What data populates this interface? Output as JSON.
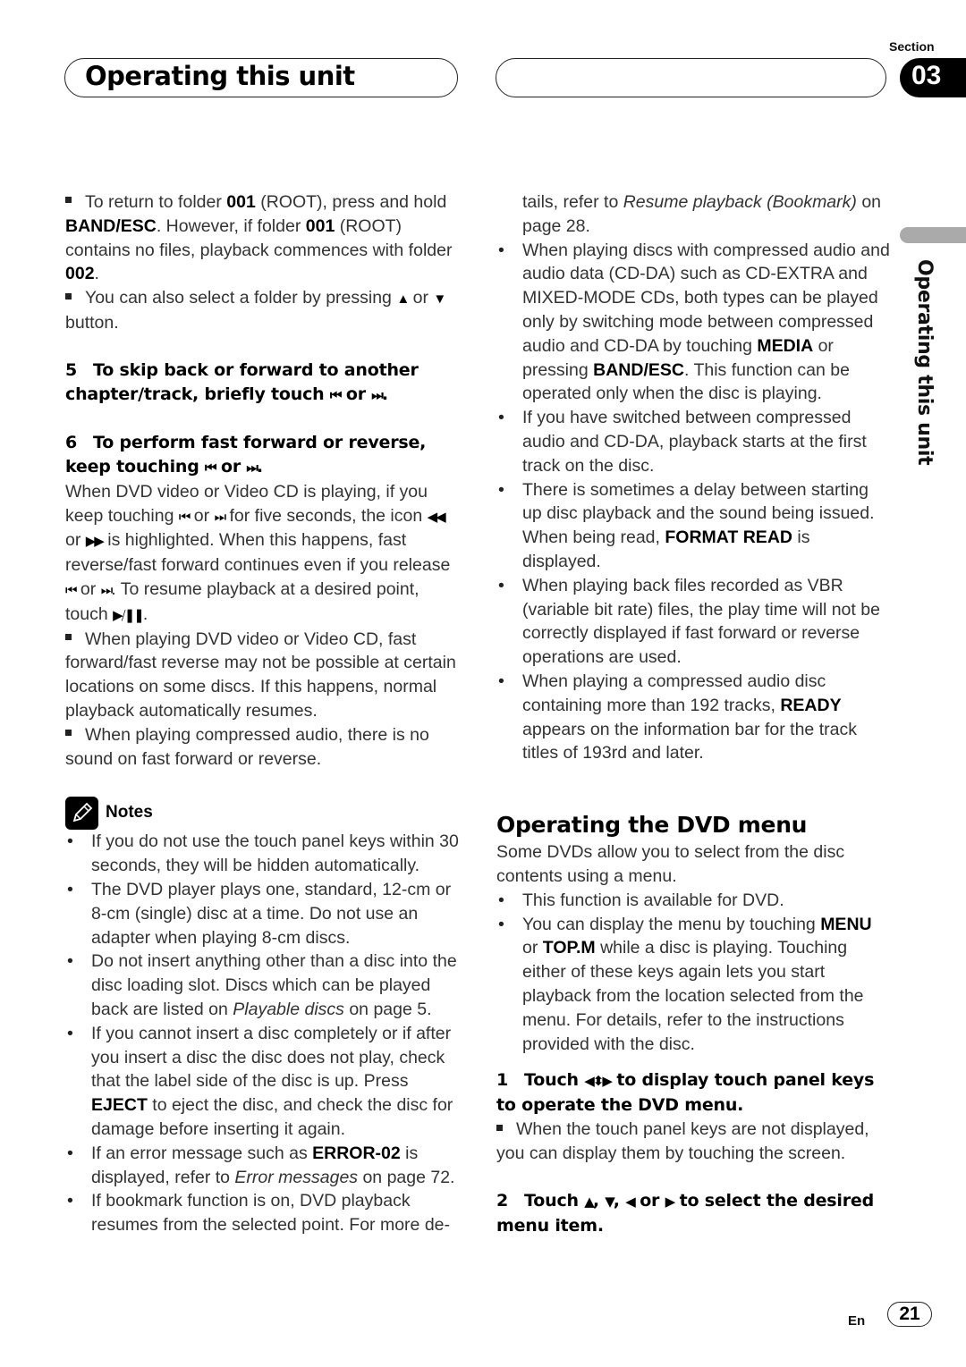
{
  "header": {
    "title": "Operating this unit",
    "section_label": "Section",
    "section_number": "03"
  },
  "side_tab": {
    "label": "Operating this unit"
  },
  "left_column": {
    "p1": {
      "a": "To return to folder ",
      "b1": "001",
      "c": " (ROOT), press and hold ",
      "b2": "BAND/ESC",
      "d": ". However, if folder ",
      "b3": "001",
      "e": " (ROOT) contains no files, playback commences with folder ",
      "b4": "002",
      "f": "."
    },
    "p2": {
      "a": "You can also select a folder by pressing ",
      "up": "▲",
      "b": " or ",
      "down": "▼",
      "c": " button."
    },
    "step5": {
      "num": "5",
      "text": "To skip back or forward to another chapter/track, briefly touch ",
      "prev": "⏮",
      "or": " or ",
      "next": "⏭",
      "end": "."
    },
    "step6": {
      "num": "6",
      "text": "To perform fast forward or reverse, keep touching ",
      "prev": "⏮",
      "or": " or ",
      "next": "⏭",
      "end": "."
    },
    "step6_body": {
      "a": "When DVD video or Video CD is playing, if you keep touching ",
      "prev": "⏮",
      "or1": " or ",
      "next": "⏭",
      "b": " for five seconds, the icon ",
      "rew": "◀◀",
      "or2": " or ",
      "ff": "▶▶",
      "c": " is highlighted. When this happens, fast reverse/fast forward continues even if you release ",
      "prev2": "⏮",
      "or3": " or ",
      "next2": "⏭",
      "d": ". To resume playback at a desired point, touch ",
      "playpause": "▶/❚❚",
      "e": "."
    },
    "p3": "When playing DVD video or Video CD, fast forward/fast reverse may not be possible at certain locations on some discs. If this happens, normal playback automatically resumes.",
    "p4": "When playing compressed audio, there is no sound on fast forward or reverse.",
    "notes": {
      "label": "Notes",
      "items": [
        {
          "text": "If you do not use the touch panel keys within 30 seconds, they will be hidden automatically."
        },
        {
          "text": "The DVD player plays one, standard, 12-cm or 8-cm (single) disc at a time. Do not use an adapter when playing 8-cm discs."
        },
        {
          "a": "Do not insert anything other than a disc into the disc loading slot. Discs which can be played back are listed on ",
          "i": "Playable discs",
          "b": " on page 5."
        },
        {
          "a": "If you cannot insert a disc completely or if after you insert a disc the disc does not play, check that the label side of the disc is up. Press ",
          "bold": "EJECT",
          "b": " to eject the disc, and check the disc for damage before inserting it again."
        },
        {
          "a": "If an error message such as ",
          "bold": "ERROR-02",
          "b": " is displayed, refer to ",
          "i": "Error messages",
          "c": " on page 72."
        },
        {
          "a": "If bookmark function is on, DVD playback resumes from the selected point. For more de-"
        }
      ]
    }
  },
  "right_column": {
    "cont": {
      "a": "tails, refer to ",
      "i": "Resume playback (Bookmark)",
      "b": " on page 28."
    },
    "items": [
      {
        "a": "When playing discs with compressed audio and audio data (CD-DA) such as CD-EXTRA and MIXED-MODE CDs, both types can be played only by switching mode between compressed audio and CD-DA by touching ",
        "b1": "MEDIA",
        "c": " or pressing ",
        "b2": "BAND/ESC",
        "d": ". This function can be operated only when the disc is playing."
      },
      {
        "a": "If you have switched between compressed audio and CD-DA, playback starts at the first track on the disc."
      },
      {
        "a": "There is sometimes a delay between starting up disc playback and the sound being issued. When being read, ",
        "b1": "FORMAT READ",
        "c": " is displayed."
      },
      {
        "a": "When playing back files recorded as VBR (variable bit rate) files, the play time will not be correctly displayed if fast forward or reverse operations are used."
      },
      {
        "a": "When playing a compressed audio disc containing more than 192 tracks, ",
        "b1": "READY",
        "c": " appears on the information bar for the track titles of 193rd and later."
      }
    ],
    "dvd_menu": {
      "heading": "Operating the DVD menu",
      "intro": "Some DVDs allow you to select from the disc contents using a menu.",
      "bullets": [
        {
          "a": "This function is available for DVD."
        },
        {
          "a": "You can display the menu by touching ",
          "b1": "MENU",
          "c": " or ",
          "b2": "TOP.M",
          "d": " while a disc is playing. Touching either of these keys again lets you start playback from the location selected from the menu. For details, refer to the instructions provided with the disc."
        }
      ],
      "step1": {
        "num": "1",
        "a": "Touch ",
        "sym": "◀⬍▶",
        "b": " to display touch panel keys to operate the DVD menu."
      },
      "step1_note": "When the touch panel keys are not displayed, you can display them by touching the screen.",
      "step2": {
        "num": "2",
        "a": "Touch ",
        "up": "▲",
        "c1": ", ",
        "down": "▼",
        "c2": ", ",
        "left": "◀",
        "or": " or ",
        "right": "▶",
        "b": " to select the desired menu item."
      }
    }
  },
  "footer": {
    "lang": "En",
    "page": "21"
  }
}
